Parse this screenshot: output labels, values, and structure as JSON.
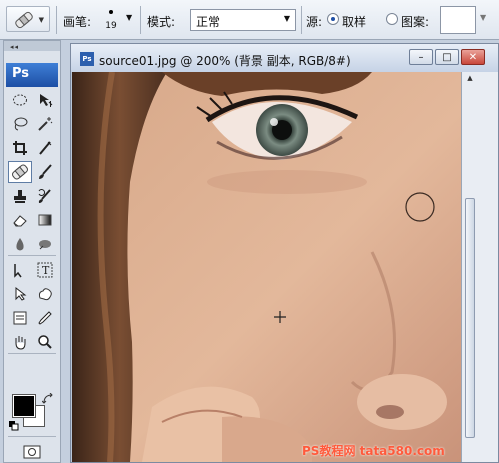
{
  "options_bar": {
    "brush_label": "画笔:",
    "brush_size": "19",
    "mode_label": "模式:",
    "mode_value": "正常",
    "source_label": "源:",
    "sampled_label": "取样",
    "pattern_label": "图案:"
  },
  "toolbox": {
    "logo": "Ps"
  },
  "document": {
    "icon_text": "Ps",
    "title": "source01.jpg @ 200% (背景 副本, RGB/8#)",
    "minimize": "–",
    "maximize": "□",
    "close": "✕"
  },
  "watermark": "PS教程网 tata580.com",
  "colors": {
    "foreground": "#000000",
    "background": "#ffffff"
  }
}
